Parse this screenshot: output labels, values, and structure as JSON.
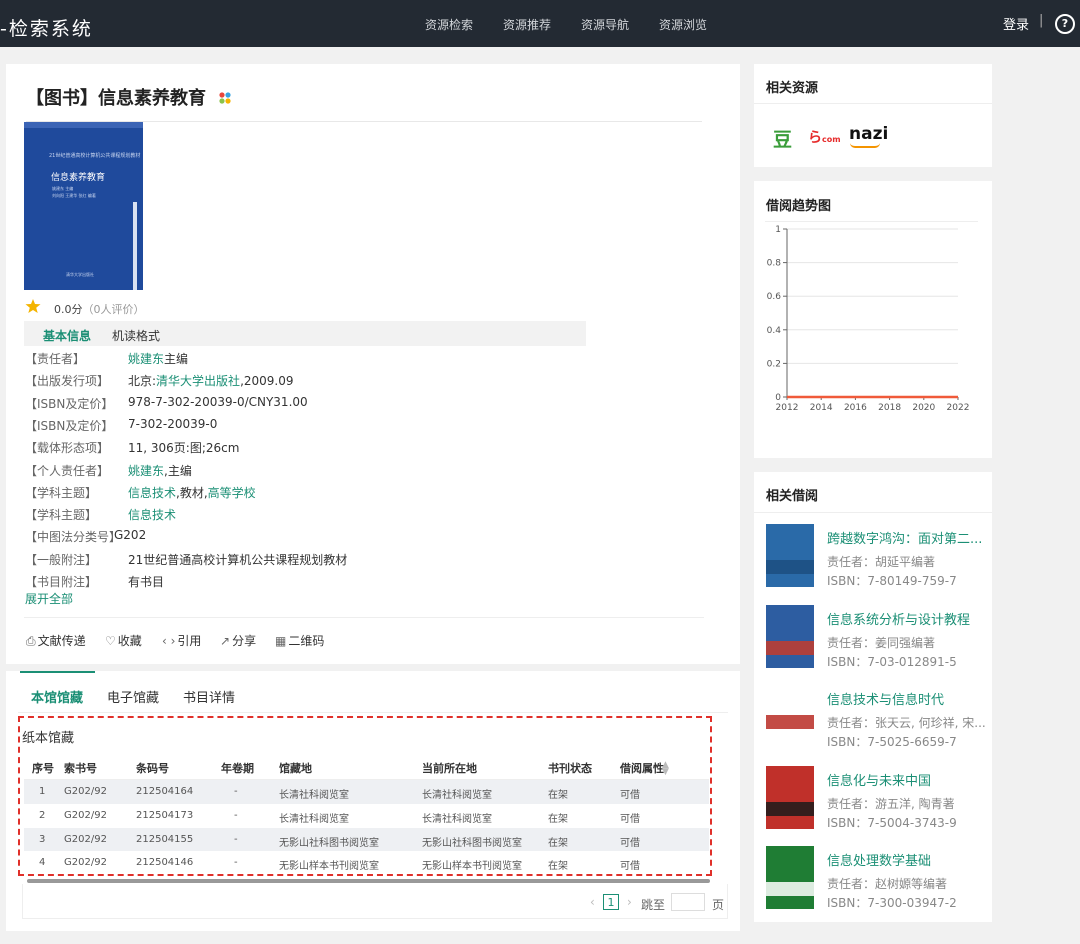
{
  "app": {
    "title": "检索系统",
    "nav": [
      "资源检索",
      "资源推荐",
      "资源导航",
      "资源浏览"
    ],
    "login": "登录",
    "help": "?"
  },
  "book": {
    "type_tag": "【图书】",
    "title": "信息素养教育",
    "cover": {
      "top_line": "21世纪普通高校计算机公共课程规划教材",
      "title": "信息素养教育",
      "lines": [
        "姚建东  主编",
        "刘向阳  王建华  张红  编著",
        "清华大学出版社"
      ]
    },
    "rating": {
      "score": "0.0分",
      "count": "（0人评价）"
    },
    "tabs": [
      "基本信息",
      "机读格式"
    ],
    "fields": [
      {
        "label": "【责任者】",
        "parts": [
          {
            "text": "姚建东",
            "link": true
          },
          {
            "text": "主编",
            "link": false
          }
        ]
      },
      {
        "label": "【出版发行项】",
        "parts": [
          {
            "text": "北京:",
            "link": false
          },
          {
            "text": "清华大学出版社",
            "link": true
          },
          {
            "text": ",2009.09",
            "link": false
          }
        ]
      },
      {
        "label": "【ISBN及定价】",
        "parts": [
          {
            "text": "978-7-302-20039-0/CNY31.00",
            "link": false
          }
        ]
      },
      {
        "label": "【ISBN及定价】",
        "parts": [
          {
            "text": "7-302-20039-0",
            "link": false
          }
        ]
      },
      {
        "label": "【载体形态项】",
        "parts": [
          {
            "text": "11, 306页:图;26cm",
            "link": false
          }
        ]
      },
      {
        "label": "【个人责任者】",
        "parts": [
          {
            "text": "姚建东",
            "link": true
          },
          {
            "text": ",主编",
            "link": false
          }
        ]
      },
      {
        "label": "【学科主题】",
        "parts": [
          {
            "text": "信息技术",
            "link": true
          },
          {
            "text": ",教材,",
            "link": false
          },
          {
            "text": "高等学校",
            "link": true
          }
        ]
      },
      {
        "label": "【学科主题】",
        "parts": [
          {
            "text": "信息技术",
            "link": true
          }
        ]
      },
      {
        "label": "【中图法分类号】",
        "parts": [
          {
            "text": "G202",
            "link": false
          }
        ]
      },
      {
        "label": "【一般附注】",
        "parts": [
          {
            "text": "21世纪普通高校计算机公共课程规划教材",
            "link": false
          }
        ]
      },
      {
        "label": "【书目附注】",
        "parts": [
          {
            "text": "有书目",
            "link": false
          }
        ]
      }
    ],
    "expand": "展开全部",
    "actions": [
      {
        "icon": "document-transfer-icon",
        "glyph": "⎙",
        "label": "文献传递"
      },
      {
        "icon": "heart-icon",
        "glyph": "♡",
        "label": "收藏"
      },
      {
        "icon": "quote-icon",
        "glyph": "‹ ›",
        "label": "引用"
      },
      {
        "icon": "share-icon",
        "glyph": "↗",
        "label": "分享"
      },
      {
        "icon": "qrcode-icon",
        "glyph": "▦",
        "label": "二维码"
      }
    ]
  },
  "holdings": {
    "tabs": [
      "本馆馆藏",
      "电子馆藏",
      "书目详情"
    ],
    "section_title": "纸本馆藏",
    "columns": [
      "序号",
      "索书号",
      "条码号",
      "年卷期",
      "馆藏地",
      "当前所在地",
      "书刊状态",
      "借阅属性"
    ],
    "rows": [
      [
        "1",
        "G202/92",
        "212504164",
        "-",
        "长清社科阅览室",
        "长清社科阅览室",
        "在架",
        "可借"
      ],
      [
        "2",
        "G202/92",
        "212504173",
        "-",
        "长清社科阅览室",
        "长清社科阅览室",
        "在架",
        "可借"
      ],
      [
        "3",
        "G202/92",
        "212504155",
        "-",
        "无影山社科图书阅览室",
        "无影山社科图书阅览室",
        "在架",
        "可借"
      ],
      [
        "4",
        "G202/92",
        "212504146",
        "-",
        "无影山样本书刊阅览室",
        "无影山样本书刊阅览室",
        "在架",
        "可借"
      ]
    ],
    "pager": {
      "current": "1",
      "goto": "跳至",
      "unit": "页"
    }
  },
  "related_resources": {
    "title": "相关资源",
    "logos": [
      "豆",
      "dangdang",
      "nazi"
    ]
  },
  "borrow_trend": {
    "title": "借阅趋势图"
  },
  "chart_data": {
    "type": "line",
    "x": [
      2012,
      2013,
      2014,
      2015,
      2016,
      2017,
      2018,
      2019,
      2020,
      2021,
      2022
    ],
    "series": [
      {
        "values": [
          0,
          0,
          0,
          0,
          0,
          0,
          0,
          0,
          0,
          0,
          0
        ],
        "color": "#f05a3a"
      }
    ],
    "xticks": [
      "2012",
      "2014",
      "2016",
      "2018",
      "2020",
      "2022"
    ],
    "yticks": [
      "0",
      "0.2",
      "0.4",
      "0.6",
      "0.8",
      "1"
    ],
    "ylim": [
      0,
      1
    ],
    "title": "",
    "xlabel": "",
    "ylabel": "",
    "grid": true
  },
  "related_borrow": {
    "title": "相关借阅",
    "items": [
      {
        "title": "跨越数字鸿沟：面对第二...",
        "author": "责任者：胡延平编著",
        "isbn": "ISBN：7-80149-759-7"
      },
      {
        "title": "信息系统分析与设计教程",
        "author": "责任者：姜同强编著",
        "isbn": "ISBN：7-03-012891-5"
      },
      {
        "title": "信息技术与信息时代",
        "author": "责任者：张天云, 何珍祥, 宋...",
        "isbn": "ISBN：7-5025-6659-7"
      },
      {
        "title": "信息化与未来中国",
        "author": "责任者：游五洋, 陶青著",
        "isbn": "ISBN：7-5004-3743-9"
      },
      {
        "title": "信息处理数学基础",
        "author": "责任者：赵树嫄等编著",
        "isbn": "ISBN：7-300-03947-2"
      }
    ]
  },
  "colors": {
    "accent": "#1b8f75",
    "nav_bg": "#232a33",
    "highlight": "#e0302a",
    "chart_line": "#f05a3a"
  }
}
